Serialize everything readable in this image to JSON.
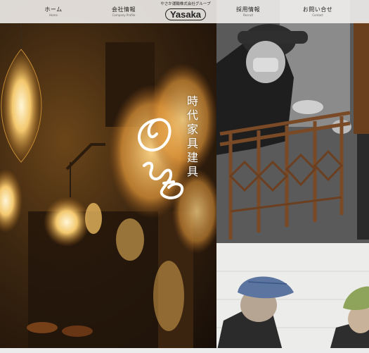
{
  "nav": {
    "items": [
      {
        "ja": "ホーム",
        "en": "Home"
      },
      {
        "ja": "会社情報",
        "en": "Company Profile"
      },
      {
        "ja": "採用情報",
        "en": "Recruit"
      },
      {
        "ja": "お問い合せ",
        "en": "Contact"
      }
    ],
    "logo": {
      "tagline": "やさか運輸株式会社グループ",
      "name": "Yasaka"
    }
  },
  "hero": {
    "vertical_title": "時代家具建具",
    "script_mark": "のむら"
  },
  "colors": {
    "amber": "#f0b45a",
    "dark": "#160d07"
  }
}
